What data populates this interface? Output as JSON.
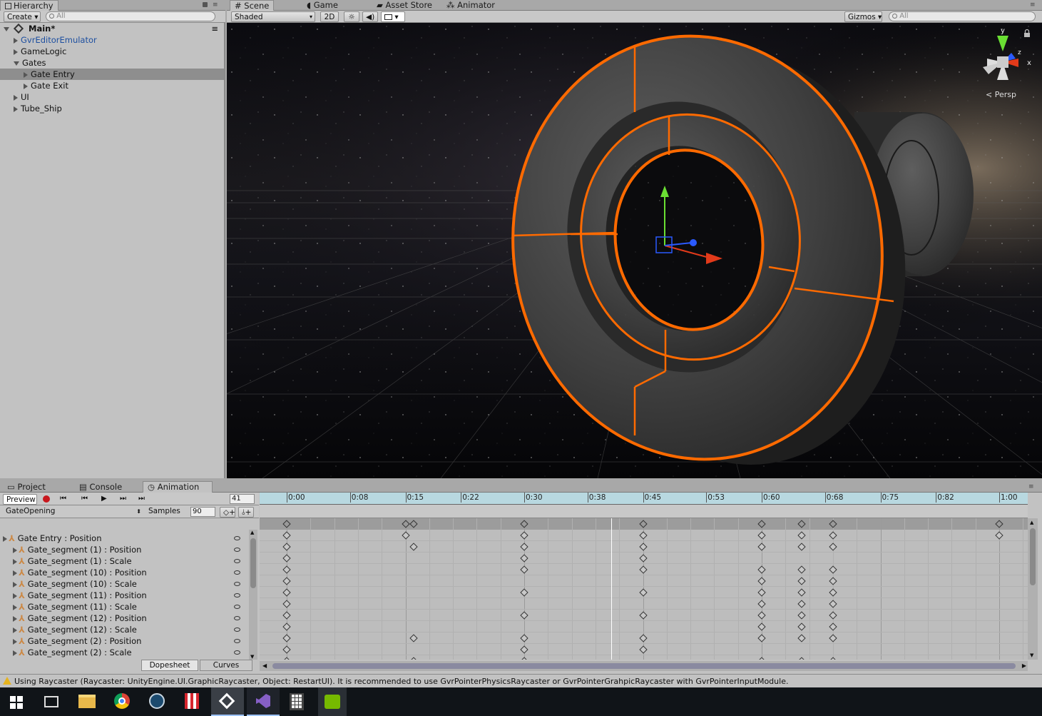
{
  "hierarchy": {
    "tab_label": "Hierarchy",
    "create_label": "Create",
    "search_placeholder": "All",
    "scene_name": "Main*",
    "items": [
      {
        "label": "GvrEditorEmulator",
        "indent": 0,
        "expand": "collapsed",
        "prefab": true
      },
      {
        "label": "GameLogic",
        "indent": 0,
        "expand": "collapsed"
      },
      {
        "label": "Gates",
        "indent": 0,
        "expand": "expanded"
      },
      {
        "label": "Gate Entry",
        "indent": 1,
        "expand": "collapsed",
        "selected": true
      },
      {
        "label": "Gate Exit",
        "indent": 1,
        "expand": "collapsed"
      },
      {
        "label": "UI",
        "indent": 0,
        "expand": "collapsed"
      },
      {
        "label": "Tube_Ship",
        "indent": 0,
        "expand": "collapsed"
      }
    ]
  },
  "scene": {
    "tabs": [
      {
        "label": "Scene",
        "icon": "grid-icon",
        "active": true
      },
      {
        "label": "Game",
        "icon": "pacman-icon"
      },
      {
        "label": "Asset Store",
        "icon": "store-icon"
      },
      {
        "label": "Animator",
        "icon": "animator-icon"
      }
    ],
    "shading_mode": "Shaded",
    "mode_2d": "2D",
    "gizmos_label": "Gizmos",
    "search_placeholder": "All",
    "persp_label": "Persp",
    "axis_y": "y",
    "axis_z": "z",
    "axis_x": "x"
  },
  "bottom_tabs": [
    {
      "label": "Project",
      "icon": "folder-icon"
    },
    {
      "label": "Console",
      "icon": "console-icon"
    },
    {
      "label": "Animation",
      "icon": "clock-icon",
      "active": true
    }
  ],
  "animation": {
    "preview_label": "Preview",
    "frame": "41",
    "clip_name": "GateOpening",
    "samples_label": "Samples",
    "samples_value": "90",
    "dopesheet_label": "Dopesheet",
    "curves_label": "Curves",
    "timeline_labels": [
      "0:00",
      "0:08",
      "0:15",
      "0:22",
      "0:30",
      "0:38",
      "0:45",
      "0:53",
      "0:60",
      "0:68",
      "0:75",
      "0:82",
      "1:00"
    ],
    "playhead_frame": 41,
    "properties": [
      {
        "label": "Gate Entry : Position",
        "indent": 0,
        "keys": [
          0,
          15,
          30,
          45,
          60,
          65,
          69,
          90
        ]
      },
      {
        "label": "Gate_segment (1) : Position",
        "indent": 1,
        "keys": [
          0,
          16,
          30,
          45,
          60,
          65,
          69
        ]
      },
      {
        "label": "Gate_segment (1) : Scale",
        "indent": 1,
        "keys": [
          0,
          30,
          45
        ]
      },
      {
        "label": "Gate_segment (10) : Position",
        "indent": 1,
        "keys": [
          0,
          30,
          45,
          60,
          65,
          69
        ]
      },
      {
        "label": "Gate_segment (10) : Scale",
        "indent": 1,
        "keys": [
          0,
          60,
          65,
          69
        ]
      },
      {
        "label": "Gate_segment (11) : Position",
        "indent": 1,
        "keys": [
          0,
          30,
          45,
          60,
          65,
          69
        ]
      },
      {
        "label": "Gate_segment (11) : Scale",
        "indent": 1,
        "keys": [
          0,
          60,
          65,
          69
        ]
      },
      {
        "label": "Gate_segment (12) : Position",
        "indent": 1,
        "keys": [
          0,
          30,
          45,
          60,
          65,
          69
        ]
      },
      {
        "label": "Gate_segment (12) : Scale",
        "indent": 1,
        "keys": [
          0,
          60,
          65,
          69
        ]
      },
      {
        "label": "Gate_segment (2) : Position",
        "indent": 1,
        "keys": [
          0,
          16,
          30,
          45,
          60,
          65,
          69
        ]
      },
      {
        "label": "Gate_segment (2) : Scale",
        "indent": 1,
        "keys": [
          0,
          30,
          45
        ]
      }
    ],
    "summary_keys": [
      0,
      15,
      16,
      30,
      45,
      60,
      65,
      69,
      90
    ]
  },
  "status": {
    "message": "Using Raycaster (Raycaster: UnityEngine.UI.GraphicRaycaster, Object: RestartUI). It is recommended to use GvrPointerPhysicsRaycaster or GvrPointerGrahpicRaycaster with GvrPointerInputModule."
  },
  "taskbar": {
    "icons": [
      "windows-start-icon",
      "task-view-icon",
      "file-explorer-icon",
      "chrome-icon",
      "steam-icon",
      "popcorn-icon",
      "unity-icon",
      "visual-studio-icon",
      "calculator-icon",
      "nvidia-icon"
    ]
  }
}
